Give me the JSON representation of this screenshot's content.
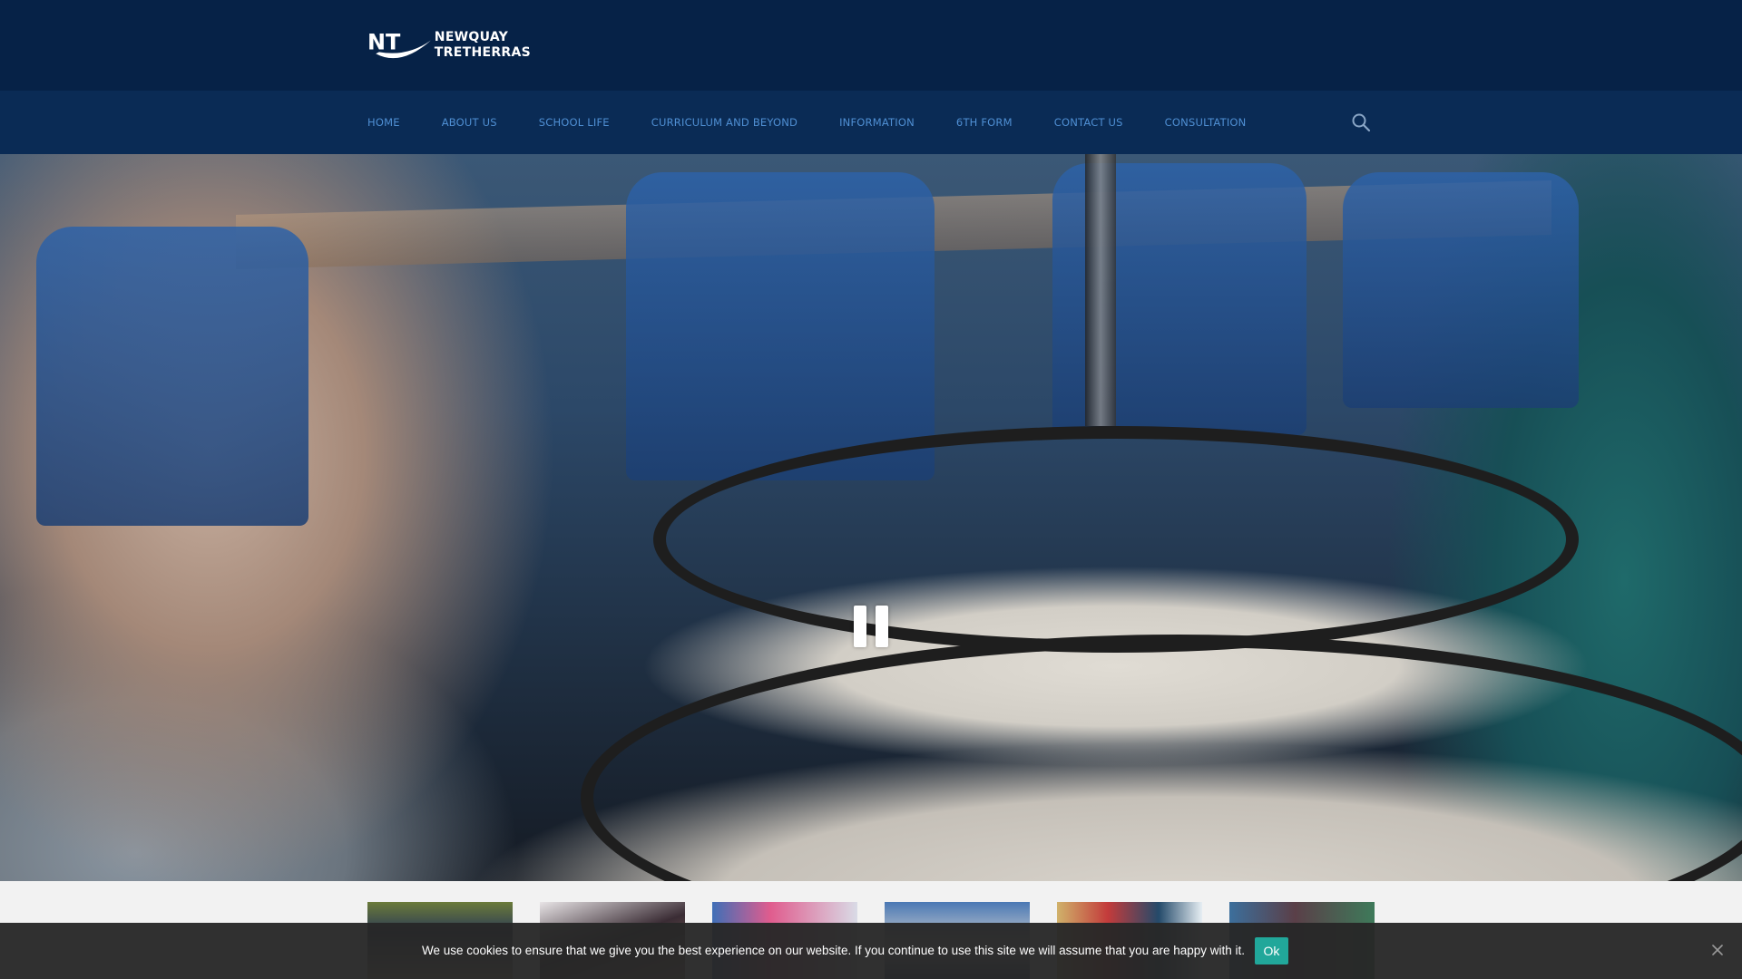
{
  "header": {
    "logo_line1": "NEWQUAY",
    "logo_line2": "TRETHERRAS",
    "logo_mark": "NT",
    "background_color": "#062247"
  },
  "nav": {
    "background_color": "#0a2b55",
    "link_color": "#4f8fd3",
    "items": [
      {
        "label": "HOME"
      },
      {
        "label": "ABOUT US"
      },
      {
        "label": "SCHOOL LIFE"
      },
      {
        "label": "CURRICULUM AND BEYOND"
      },
      {
        "label": "INFORMATION"
      },
      {
        "label": "6TH FORM"
      },
      {
        "label": "CONTACT US"
      },
      {
        "label": "CONSULTATION"
      }
    ],
    "search_icon": "search-icon"
  },
  "hero": {
    "media": "video",
    "state": "playing",
    "control_icon": "pause-icon"
  },
  "thumbnails": {
    "count": 6
  },
  "cookie_bar": {
    "message": "We use cookies to ensure that we give you the best experience on our website. If you continue to use this site we will assume that you are happy with it.",
    "ok_label": "Ok",
    "ok_color": "#21a79a",
    "close_icon": "close-icon"
  }
}
